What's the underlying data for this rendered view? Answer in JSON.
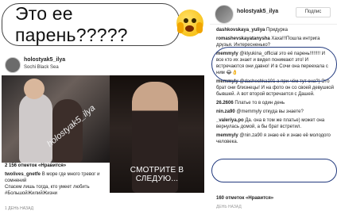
{
  "headline": {
    "text": "Это ее парень?????"
  },
  "left_post": {
    "account_name": "holostyak5_ilya",
    "account_sub": "Sochi Black Sea",
    "watermark": "holostyak5_ilya",
    "video_caption": "СМОТРИТЕ В СЛЕДУЮ...",
    "likes": "2 156 отметок «Нравится»",
    "comments": [
      {
        "user": "twolives_gnetfe",
        "text": "В море где много тревог и сомнений"
      },
      {
        "user": "",
        "text": "Спасем лишь тогда, кто умеет любить"
      },
      {
        "user": "",
        "text": "#БольшойЖилийЖизни"
      }
    ],
    "time": "1 ДЕНЬ НАЗАД"
  },
  "right_post": {
    "username": "holostyak5_ilya",
    "follow_label": "Подпис",
    "comments": [
      {
        "user": "dashkovskaya_yuliya",
        "text": "Придурка"
      },
      {
        "user": "romashevskayatanysha",
        "text": "Хаха!!!Пошла интрига друзья. Интересненько?"
      },
      {
        "user": "memmyly",
        "text": "@klyukina_official это её парень!!!!!!!! И все кто их знает и видел понимают это! И встречаются они давно! И в Сочи она переехала с ним 😂👌"
      },
      {
        "user": "memmyly",
        "text": "@dashechka101 а при чём тут она?) Это брат они близнецы! И на фото он со своей девушкой бывшей. А вот второй встречается с Дашей."
      },
      {
        "user": "26.2606",
        "text": "Платье то в один день"
      },
      {
        "user": "nin.za90",
        "text": "@memmyly откуда вы знаете?"
      },
      {
        "user": "_valeriya.po",
        "text": "Да. она в том же платье) может она вернулась домой, а бы брат встретил."
      },
      {
        "user": "memmyly",
        "text": "@nin.za90 я знаю её и знаю её молодого человека."
      }
    ],
    "likes_count": "160 отметок «Нравится»",
    "time": "ДЕНЬ НАЗАД"
  }
}
